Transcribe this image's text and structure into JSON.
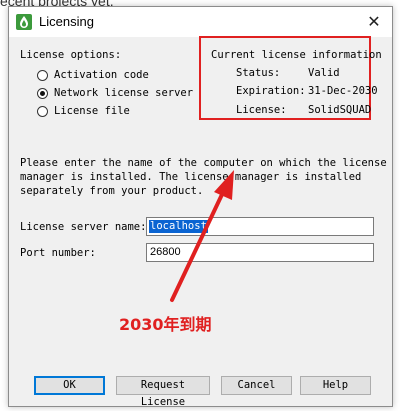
{
  "background_text": "ecent projects yet.",
  "window": {
    "title": "Licensing",
    "close_glyph": "✕"
  },
  "license_options": {
    "heading": "License options:",
    "options": [
      {
        "label": "Activation code",
        "checked": false
      },
      {
        "label": "Network license server",
        "checked": true
      },
      {
        "label": "License file",
        "checked": false
      }
    ]
  },
  "current_license": {
    "heading": "Current license information",
    "status_label": "Status:",
    "status_value": "Valid",
    "expiration_label": "Expiration:",
    "expiration_value": "31-Dec-2030",
    "license_label": "License:",
    "license_value": "SolidSQUAD"
  },
  "instructions": [
    "Please enter the name of the computer on which the license",
    "manager is installed. The license manager is installed",
    "separately from your product."
  ],
  "server_name": {
    "label": "License server name:",
    "value": "localhost"
  },
  "port": {
    "label": "Port number:",
    "value": "26800"
  },
  "annotation": {
    "text": "2030年到期",
    "color": "#e02020"
  },
  "buttons": {
    "ok": "OK",
    "request": "Request License",
    "cancel": "Cancel",
    "help": "Help"
  },
  "colors": {
    "accent": "#0078d7",
    "highlight": "#e02020",
    "selection": "#0a64d2"
  }
}
